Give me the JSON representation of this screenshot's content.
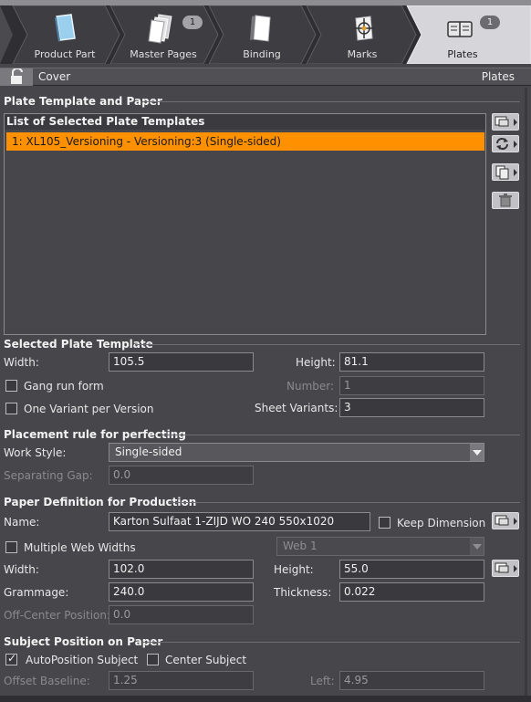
{
  "tabs": [
    {
      "label": "Product Part",
      "badge": ""
    },
    {
      "label": "Master Pages",
      "badge": "1"
    },
    {
      "label": "Binding",
      "badge": ""
    },
    {
      "label": "Marks",
      "badge": ""
    },
    {
      "label": "Plates",
      "badge": "1",
      "active": true
    }
  ],
  "breadcrumb": {
    "section": "Cover",
    "view": "Plates"
  },
  "plate_template": {
    "title": "Plate Template and Paper",
    "list_header": "List of Selected Plate Templates",
    "items": [
      "1: XL105_Versioning - Versioning:3 (Single-sided)"
    ]
  },
  "selected_template": {
    "title": "Selected Plate Template",
    "width_label": "Width:",
    "width": "105.5",
    "height_label": "Height:",
    "height": "81.1",
    "gang_run_label": "Gang run form",
    "gang_run_checked": false,
    "number_label": "Number:",
    "number": "1",
    "one_variant_label": "One Variant per Version",
    "one_variant_checked": false,
    "sheet_variants_label": "Sheet Variants:",
    "sheet_variants": "3"
  },
  "placement": {
    "title": "Placement rule for perfecting",
    "work_style_label": "Work Style:",
    "work_style": "Single-sided",
    "gap_label": "Separating Gap:",
    "gap": "0.0"
  },
  "paper": {
    "title": "Paper Definition for Production",
    "name_label": "Name:",
    "name": "Karton Sulfaat 1-ZIJD WO 240 550x1020",
    "keep_dimension_label": "Keep Dimension",
    "keep_dimension_checked": false,
    "multiple_web_label": "Multiple Web Widths",
    "multiple_web_checked": false,
    "web": "Web 1",
    "width_label": "Width:",
    "width": "102.0",
    "height_label": "Height:",
    "height": "55.0",
    "grammage_label": "Grammage:",
    "grammage": "240.0",
    "thickness_label": "Thickness:",
    "thickness": "0.022",
    "off_center_label": "Off-Center Position:",
    "off_center": "0.0"
  },
  "subject": {
    "title": "Subject Position on Paper",
    "auto_label": "AutoPosition Subject",
    "auto_checked": true,
    "center_label": "Center Subject",
    "center_checked": false,
    "offset_label": "Offset Baseline:",
    "offset": "1.25",
    "left_label": "Left:",
    "left": "4.95"
  },
  "icons": [
    "product-part-icon",
    "master-pages-icon",
    "binding-icon",
    "marks-icon",
    "plates-icon",
    "lock-icon",
    "monitor-icon",
    "refresh-icon",
    "copy-icon",
    "trash-icon"
  ],
  "colors": {
    "accent": "#ff9000",
    "panel": "#46464b",
    "active_tab": "#d6d6da"
  }
}
